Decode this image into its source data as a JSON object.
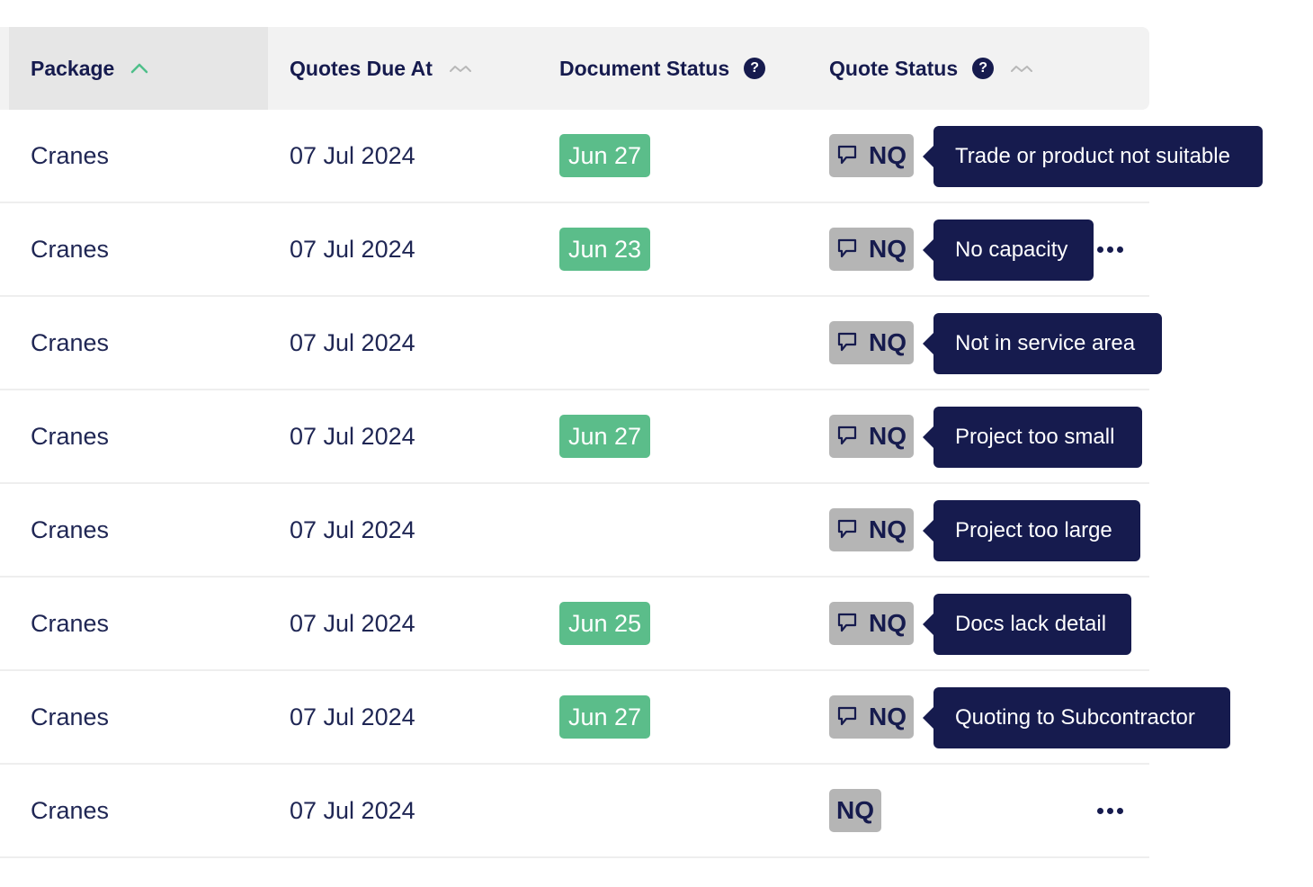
{
  "headers": {
    "package": "Package",
    "quotes_due_at": "Quotes Due At",
    "document_status": "Document Status",
    "quote_status": "Quote Status",
    "help_glyph": "?"
  },
  "colors": {
    "doc_badge": "#5bbd8a",
    "nq_badge": "#b5b5b5",
    "tooltip": "#161b4e",
    "sort_active": "#4fbf8a"
  },
  "rows": [
    {
      "package": "Cranes",
      "due": "07 Jul 2024",
      "doc": "Jun 27",
      "nq": "NQ",
      "reason": "Trade or product not suitable",
      "more": false
    },
    {
      "package": "Cranes",
      "due": "07 Jul 2024",
      "doc": "Jun 23",
      "nq": "NQ",
      "reason": "No capacity",
      "more": true
    },
    {
      "package": "Cranes",
      "due": "07 Jul 2024",
      "doc": "",
      "nq": "NQ",
      "reason": "Not in service area",
      "more": false
    },
    {
      "package": "Cranes",
      "due": "07 Jul 2024",
      "doc": "Jun 27",
      "nq": "NQ",
      "reason": "Project too small",
      "more": false
    },
    {
      "package": "Cranes",
      "due": "07 Jul 2024",
      "doc": "",
      "nq": "NQ",
      "reason": "Project too large",
      "more": false
    },
    {
      "package": "Cranes",
      "due": "07 Jul 2024",
      "doc": "Jun 25",
      "nq": "NQ",
      "reason": "Docs lack detail",
      "more": false
    },
    {
      "package": "Cranes",
      "due": "07 Jul 2024",
      "doc": "Jun 27",
      "nq": "NQ",
      "reason": "Quoting to Subcontractor",
      "more": false
    },
    {
      "package": "Cranes",
      "due": "07 Jul 2024",
      "doc": "",
      "nq": "NQ",
      "reason": "",
      "more": true
    }
  ]
}
